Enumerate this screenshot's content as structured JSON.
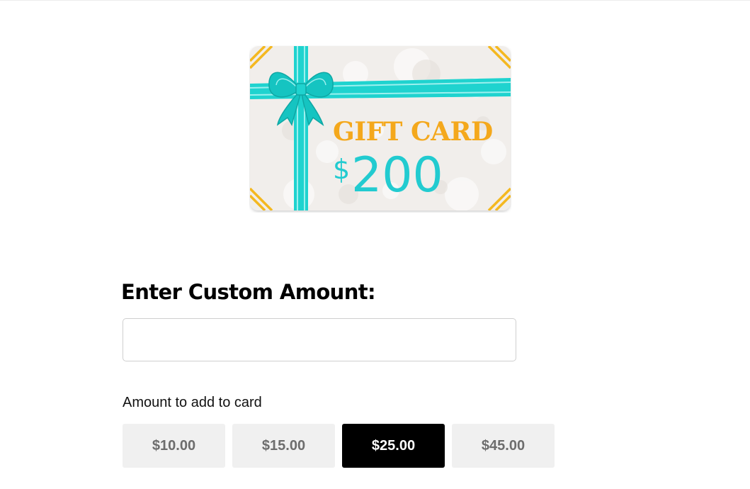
{
  "gift_card_image": {
    "text_line1": "GIFT CARD",
    "currency_symbol": "$",
    "amount": "200",
    "colors": {
      "ribbon": "#1fd3cf",
      "title": "#f4a81c",
      "amount": "#22cbd0",
      "corner": "#f4b820",
      "background": "#f1eeeb"
    }
  },
  "custom_amount": {
    "heading": "Enter Custom Amount:",
    "input_value": "",
    "input_placeholder": ""
  },
  "preset_amounts": {
    "label": "Amount to add to card",
    "options": [
      {
        "label": "$10.00",
        "selected": false
      },
      {
        "label": "$15.00",
        "selected": false
      },
      {
        "label": "$25.00",
        "selected": true
      },
      {
        "label": "$45.00",
        "selected": false
      }
    ]
  }
}
